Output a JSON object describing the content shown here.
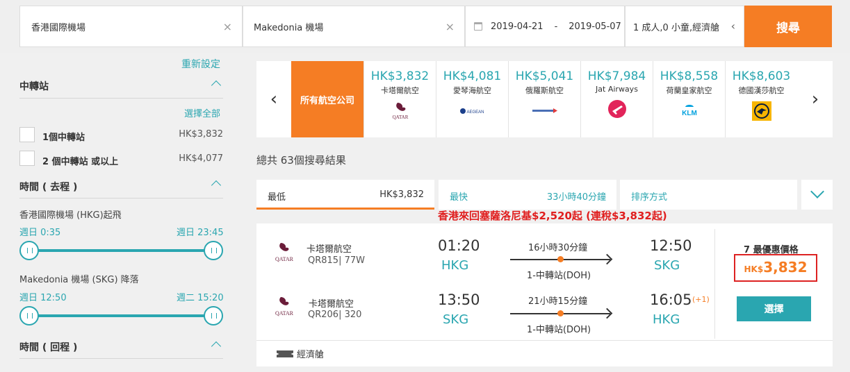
{
  "search": {
    "origin": "香港國際機場",
    "destination": "Makedonia 機場",
    "depart_date": "2019-04-21",
    "date_sep": "-",
    "return_date": "2019-05-07",
    "passengers": "1 成人,0 小童,經濟艙",
    "clear_glyph": "×",
    "pax_chevron": "‹",
    "search_label": "搜尋"
  },
  "filters": {
    "reset_label": "重新設定",
    "stops": {
      "title": "中轉站",
      "select_all": "選擇全部",
      "options": [
        {
          "label": "1個中轉站",
          "price": "HK$3,832"
        },
        {
          "label": "2 個中轉站 或以上",
          "price": "HK$4,077"
        }
      ]
    },
    "outbound": {
      "title": "時間 ( 去程 )",
      "departure_label": "香港國際機場 (HKG)起飛",
      "departure_min": "週日 0:35",
      "departure_max": "週日 23:45",
      "arrival_label": "Makedonia 機場 (SKG) 降落",
      "arrival_min": "週日 12:50",
      "arrival_max": "週二 15:20"
    },
    "return": {
      "title": "時間 ( 回程 )"
    }
  },
  "carousel": {
    "all_label": "所有航空公司",
    "airlines": [
      {
        "price": "HK$3,832",
        "name": "卡塔爾航空",
        "icon": "qatar-logo"
      },
      {
        "price": "HK$4,081",
        "name": "愛琴海航空",
        "icon": "aegean-logo"
      },
      {
        "price": "HK$5,041",
        "name": "俄羅斯航空",
        "icon": "aeroflot-logo"
      },
      {
        "price": "HK$7,984",
        "name": "Jat Airways",
        "icon": "plane-icon"
      },
      {
        "price": "HK$8,558",
        "name": "荷蘭皇家航空",
        "icon": "klm-logo"
      },
      {
        "price": "HK$8,603",
        "name": "德國漢莎航空",
        "icon": "lufthansa-logo"
      }
    ],
    "logo_text": {
      "qatar": "QATAR",
      "aegean": "AEGEAN",
      "klm": "KLM"
    }
  },
  "results": {
    "total": "總共 63個搜尋結果",
    "sort": {
      "lowest_label": "最低",
      "lowest_value": "HK$3,832",
      "fastest_label": "最快",
      "fastest_value": "33小時40分鐘",
      "sort_label": "排序方式"
    },
    "promo": "香港來回塞薩洛尼基$2,520起 (連稅$3,832起)",
    "card": {
      "legs": [
        {
          "airline": "卡塔爾航空",
          "flight": "QR815| 77W",
          "depart_time": "01:20",
          "depart_code": "HKG",
          "duration": "16小時30分鐘",
          "stops": "1-中轉站(DOH)",
          "arrive_time": "12:50",
          "arrive_code": "SKG",
          "day_offset": ""
        },
        {
          "airline": "卡塔爾航空",
          "flight": "QR206| 320",
          "depart_time": "13:50",
          "depart_code": "SKG",
          "duration": "21小時15分鐘",
          "stops": "1-中轉站(DOH)",
          "arrive_time": "16:05",
          "arrive_code": "HKG",
          "day_offset": "(+1)"
        }
      ],
      "deal_label": "7 最優惠價格",
      "price_currency": "HK$",
      "price_amount": "3,832",
      "select_label": "選擇",
      "cabin": "經濟艙"
    }
  },
  "colors": {
    "accent": "#f57d24",
    "teal": "#2aa6b0",
    "promo_red": "#e01e1e",
    "highlight_border": "#dd2222"
  }
}
